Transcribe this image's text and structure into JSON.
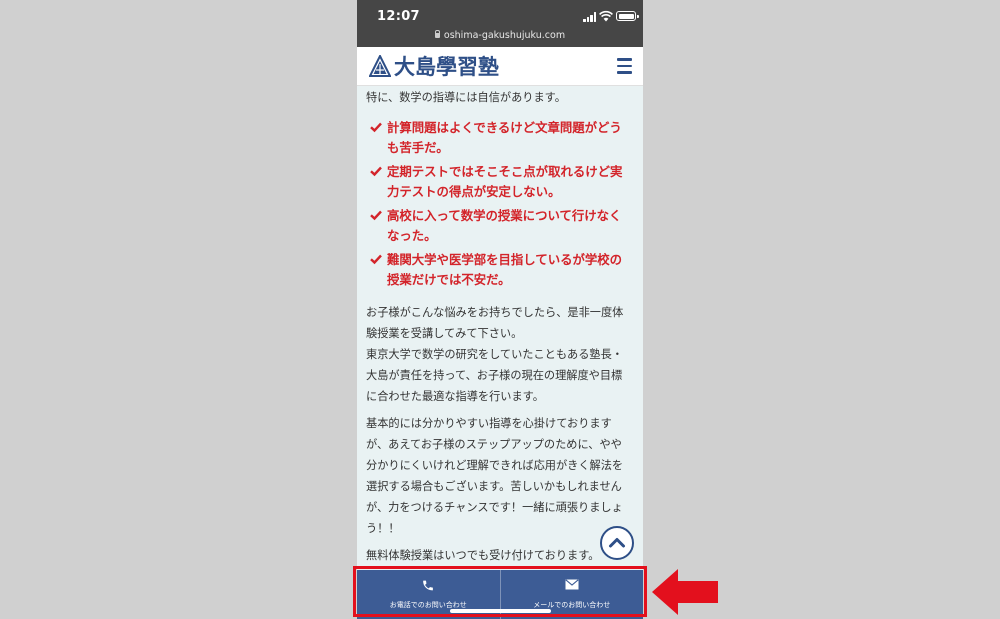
{
  "status_bar": {
    "time": "12:07",
    "url": "oshima-gakushujuku.com"
  },
  "header": {
    "logo_text": "大島學習塾",
    "menu_icon": "hamburger-menu-icon"
  },
  "content": {
    "intro": "特に、数学の指導には自信があります。",
    "checklist": [
      {
        "line1": "計算問題はよくできるけど文章問題がどう",
        "line2": "も苦手だ。"
      },
      {
        "line1": "定期テストではそこそこ点が取れるけど実",
        "line2": "力テストの得点が安定しない。"
      },
      {
        "line1": "高校に入って数学の授業について行けなく",
        "line2": "なった。"
      },
      {
        "line1": "難関大学や医学部を目指しているが学校の",
        "line2": "授業だけでは不安だ。"
      }
    ],
    "para1": [
      "お子様がこんな悩みをお持ちでしたら、是非一度体",
      "験授業を受講してみて下さい。",
      "東京大学で数学の研究をしていたこともある塾長・",
      "大島が責任を持って、お子様の現在の理解度や目標",
      "に合わせた最適な指導を行います。"
    ],
    "para2": [
      "基本的には分かりやすい指導を心掛けております",
      "が、あえてお子様のステップアップのために、やや",
      "分かりにくいけれど理解できれば応用がきく解法を",
      "選択する場合もございます。苦しいかもしれません",
      "が、力をつけるチャンスです！一緒に頑張りましょ",
      "う！！"
    ],
    "para3": "無料体験授業はいつでも受け付けております。"
  },
  "bottom_bar": {
    "phone_label": "お電話でのお問い合わせ",
    "mail_label": "メールでのお問い合わせ"
  },
  "colors": {
    "brand_blue": "#2e4f87",
    "check_red": "#d3242a",
    "bottom_bar": "#3d5c95",
    "highlight_red": "#e3101d"
  }
}
